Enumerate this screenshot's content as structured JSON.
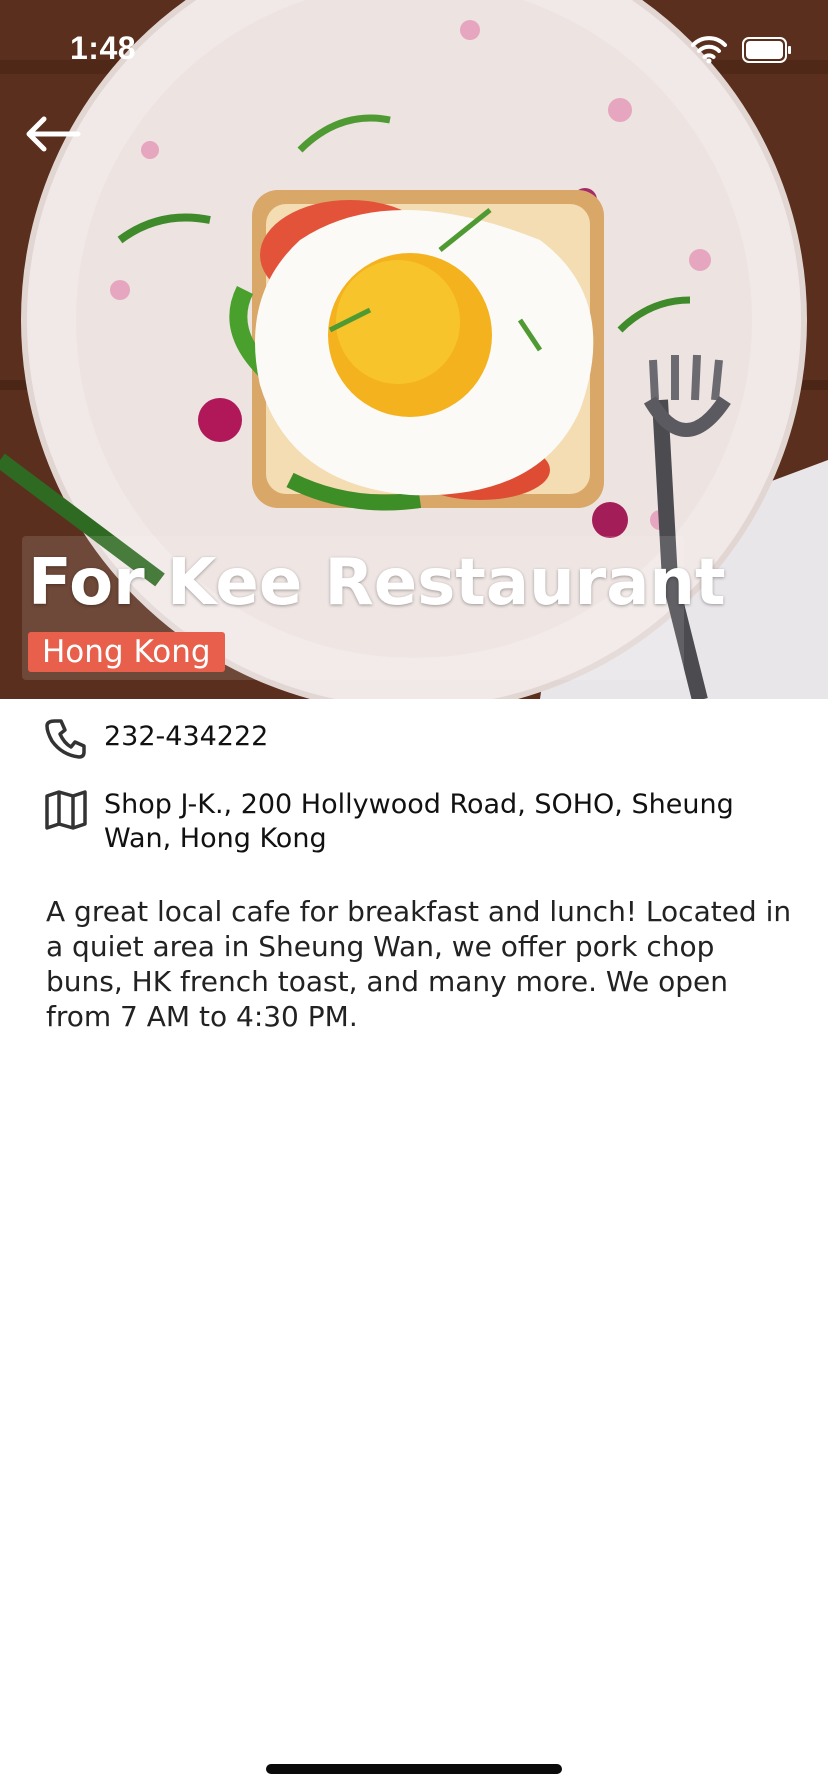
{
  "status_bar": {
    "time": "1:48"
  },
  "restaurant": {
    "name": "For Kee Restaurant",
    "location": "Hong Kong",
    "phone": "232-434222",
    "address": "Shop J-K., 200 Hollywood Road, SOHO, Sheung Wan, Hong Kong",
    "description": "A great local cafe for breakfast and lunch! Located in a quiet area in Sheung Wan, we offer pork chop buns, HK french toast, and many more. We open from 7 AM to 4:30 PM."
  },
  "icons": {
    "back": "arrow-left-icon",
    "phone": "phone-icon",
    "address": "map-icon",
    "wifi": "wifi-icon",
    "battery": "battery-icon"
  },
  "colors": {
    "badge": "#e8604c",
    "text": "#111111",
    "background": "#ffffff"
  }
}
